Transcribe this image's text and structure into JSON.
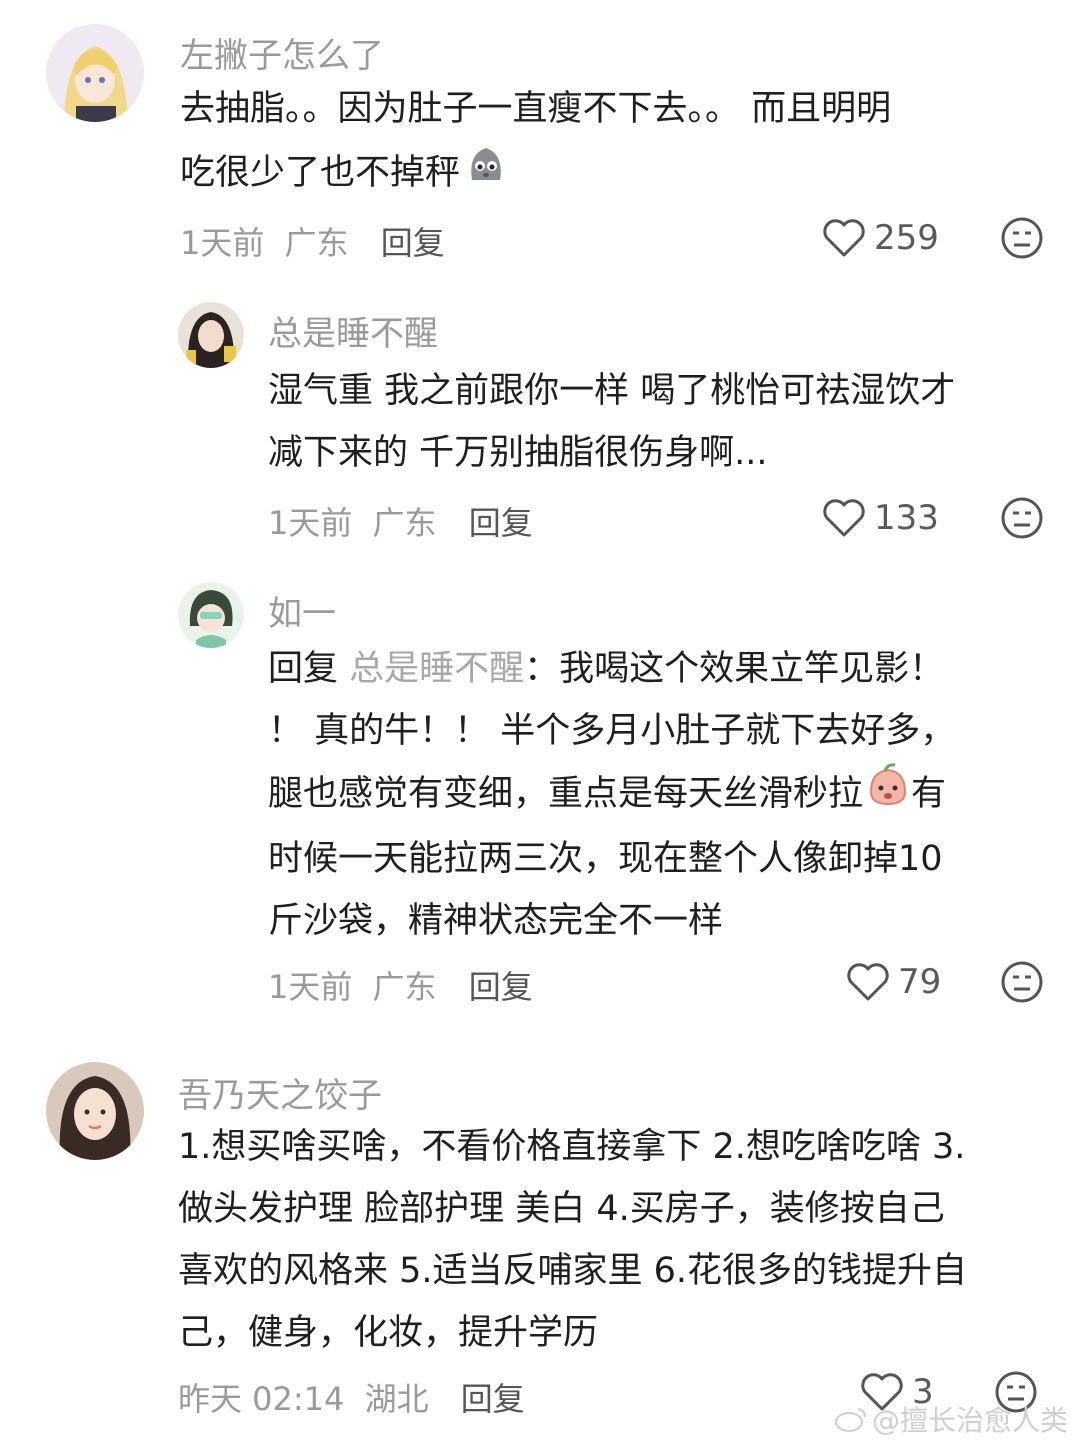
{
  "comments": [
    {
      "username": "左撇子怎么了",
      "lines": [
        "去抽脂。。因为肚子一直瘦不下去。。 而且明明",
        "吃很少了也不掉秤"
      ],
      "time": "1天前",
      "location": "广东",
      "reply_label": "回复",
      "likes": "259"
    },
    {
      "username": "总是睡不醒",
      "lines": [
        "湿气重 我之前跟你一样 喝了桃怡可祛湿饮才",
        "减下来的 千万别抽脂很伤身啊..."
      ],
      "time": "1天前",
      "location": "广东",
      "reply_label": "回复",
      "likes": "133"
    },
    {
      "username": "如一",
      "reply_prefix": "回复",
      "reply_target": "总是睡不醒",
      "line1_rest": "：我喝这个效果立竿见影！",
      "lines": [
        "！ 真的牛！！ 半个多月小肚子就下去好多，",
        "腿也感觉有变细，重点是每天丝滑秒拉",
        "时候一天能拉两三次，现在整个人像卸掉10",
        "斤沙袋，精神状态完全不一样"
      ],
      "line_after_emoji": "有",
      "time": "1天前",
      "location": "广东",
      "reply_label": "回复",
      "likes": "79"
    },
    {
      "username": "吾乃天之饺子",
      "lines": [
        "1.想买啥买啥，不看价格直接拿下 2.想吃啥吃啥 3.",
        "做头发护理 脸部护理 美白 4.买房子，装修按自己",
        "喜欢的风格来 5.适当反哺家里 6.花很多的钱提升自",
        "己，健身，化妆，提升学历"
      ],
      "time": "昨天 02:14",
      "location": "湖北",
      "reply_label": "回复",
      "likes": "3"
    }
  ],
  "watermark": "@擅长治愈人类",
  "icons": [
    "heart-icon",
    "dislike-face-icon",
    "emoji-sticker-icon",
    "weibo-logo-icon"
  ],
  "colors": {
    "username": "#9a9a9a",
    "text": "#1f1f1f",
    "meta": "#9a9a9a"
  }
}
